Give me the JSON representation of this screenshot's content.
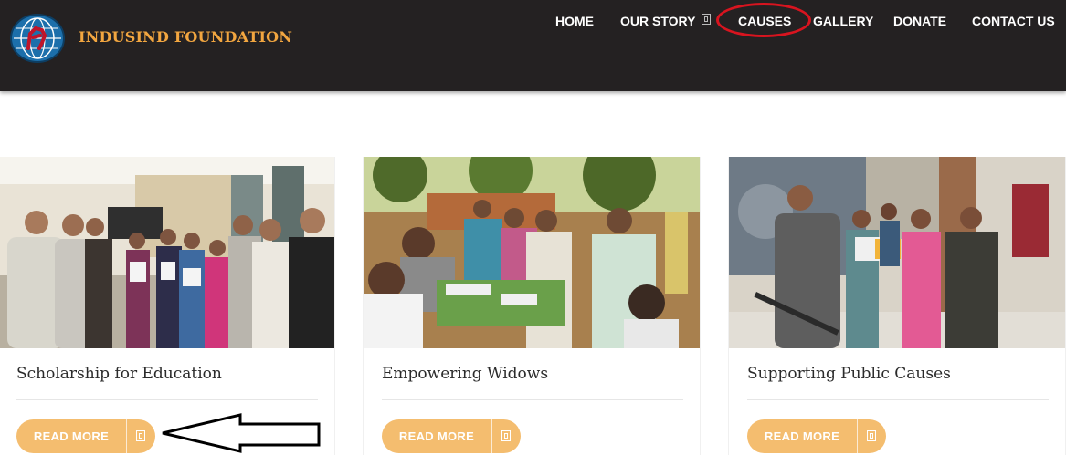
{
  "brand": {
    "name": "INDUSIND FOUNDATION"
  },
  "nav": {
    "items": [
      {
        "label": "HOME"
      },
      {
        "label": "OUR STORY"
      },
      {
        "label": "CAUSES"
      },
      {
        "label": "GALLERY"
      },
      {
        "label": "DONATE"
      },
      {
        "label": "CONTACT US"
      }
    ],
    "submenu_icon": "dropdown-icon"
  },
  "causes": [
    {
      "title": "Scholarship for Education",
      "button": "READ MORE",
      "photo": "students-with-certificates"
    },
    {
      "title": "Empowering Widows",
      "button": "READ MORE",
      "photo": "women-at-outdoor-table"
    },
    {
      "title": "Supporting Public Causes",
      "button": "READ MORE",
      "photo": "man-speaking-at-event"
    }
  ],
  "colors": {
    "header_bg": "#242122",
    "brand": "#f2a640",
    "button": "#f4bd6f",
    "annotation": "#d8141f"
  }
}
